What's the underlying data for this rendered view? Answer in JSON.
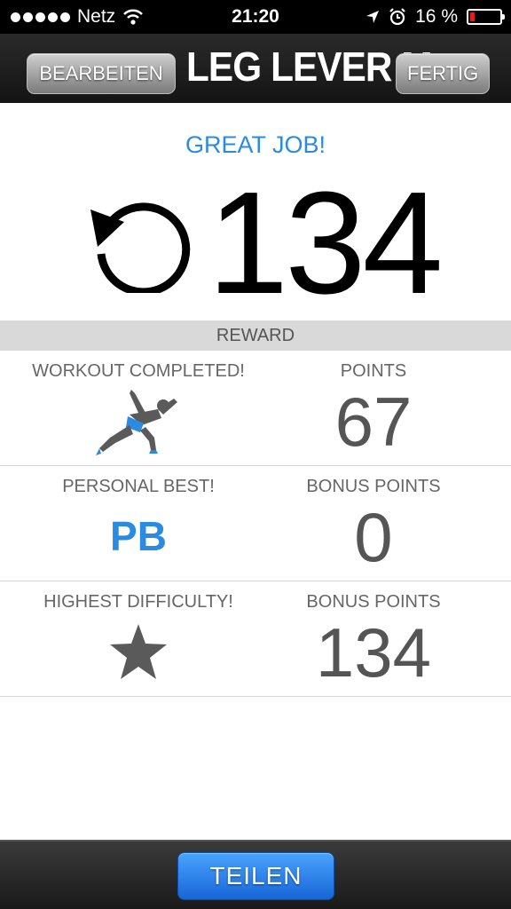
{
  "status_bar": {
    "carrier": "Netz",
    "time": "21:20",
    "battery": "16 %",
    "battery_level": 0.16,
    "battery_color": "#e0201a"
  },
  "nav": {
    "title": "LEG LEVER M",
    "edit_label": "BEARBEITEN",
    "done_label": "FERTIG"
  },
  "header": {
    "message": "GREAT JOB!",
    "count": "134",
    "icon": "repeat-icon"
  },
  "reward": {
    "title": "REWARD",
    "rows": [
      {
        "label": "WORKOUT COMPLETED!",
        "icon": "runner-icon",
        "points_label": "POINTS",
        "points": "67"
      },
      {
        "label": "PERSONAL BEST!",
        "badge": "PB",
        "points_label": "BONUS POINTS",
        "points": "0"
      },
      {
        "label": "HIGHEST DIFFICULTY!",
        "icon": "star-icon",
        "points_label": "BONUS POINTS",
        "points": "134"
      }
    ]
  },
  "footer": {
    "share_label": "TEILEN"
  },
  "colors": {
    "accent": "#2a8be0",
    "text_gray": "#555555"
  }
}
